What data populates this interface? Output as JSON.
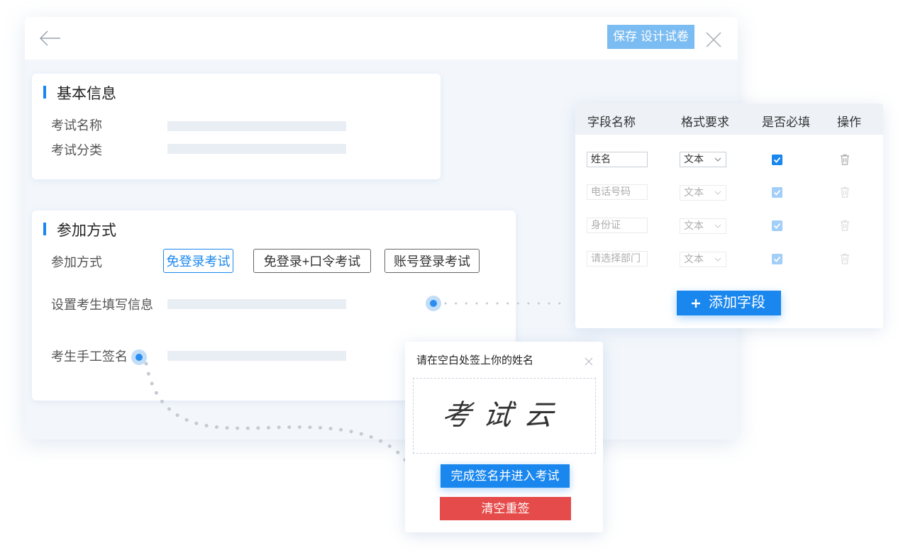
{
  "header": {
    "save_label": "保存 设计试卷"
  },
  "basic_info": {
    "title": "基本信息",
    "fields": [
      {
        "label": "考试名称"
      },
      {
        "label": "考试分类"
      }
    ]
  },
  "join": {
    "title": "参加方式",
    "method_label": "参加方式",
    "options": [
      {
        "label": "免登录考试",
        "selected": true
      },
      {
        "label": "免登录+口令考试",
        "selected": false
      },
      {
        "label": "账号登录考试",
        "selected": false
      }
    ],
    "info_label": "设置考生填写信息",
    "signature_label": "考生手工签名"
  },
  "fields_panel": {
    "columns": [
      "字段名称",
      "格式要求",
      "是否必填",
      "操作"
    ],
    "rows": [
      {
        "name": "姓名",
        "format": "文本",
        "required": true,
        "active": true
      },
      {
        "name": "电话号码",
        "format": "文本",
        "required": true,
        "active": false
      },
      {
        "name": "身份证",
        "format": "文本",
        "required": true,
        "active": false
      },
      {
        "name": "请选择部门",
        "format": "文本",
        "required": true,
        "active": false
      }
    ],
    "add_button_label": "添加字段",
    "add_icon": "plus-icon",
    "delete_icon": "trash-icon"
  },
  "signature_dialog": {
    "title": "请在空白处签上你的姓名",
    "signature_text": "考试云",
    "finish_label": "完成签名并进入考试",
    "clear_label": "清空重签"
  },
  "colors": {
    "primary": "#1a87ee",
    "save_button": "#7bbcf2",
    "danger": "#e64b4b",
    "panel_bg": "#f3f7fc"
  }
}
